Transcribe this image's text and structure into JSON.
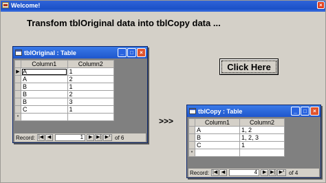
{
  "window": {
    "title": "Welcome!",
    "close": "×"
  },
  "heading": "Transfom tblOriginal data into tblCopy data ...",
  "arrow": ">>>",
  "button": {
    "label": "Click Here"
  },
  "tblOriginal": {
    "title": "tblOriginal : Table",
    "columns": [
      "Column1",
      "Column2"
    ],
    "rows": [
      [
        "A",
        "1"
      ],
      [
        "A",
        "2"
      ],
      [
        "B",
        "1"
      ],
      [
        "B",
        "2"
      ],
      [
        "B",
        "3"
      ],
      [
        "C",
        "1"
      ]
    ],
    "record_label": "Record:",
    "current": "1",
    "of_text": "of 6"
  },
  "tblCopy": {
    "title": "tblCopy : Table",
    "columns": [
      "Column1",
      "Column2"
    ],
    "rows": [
      [
        "A",
        "1, 2"
      ],
      [
        "B",
        "1, 2, 3"
      ],
      [
        "C",
        "1"
      ]
    ],
    "record_label": "Record:",
    "current": "4",
    "of_text": "of 4"
  },
  "icons": {
    "first": "|◀",
    "prev": "◀",
    "next": "▶",
    "last": "▶|",
    "new": "▶*",
    "current_row": "▶",
    "new_row": "*",
    "minimize": "_",
    "maximize": "□",
    "close": "×"
  }
}
